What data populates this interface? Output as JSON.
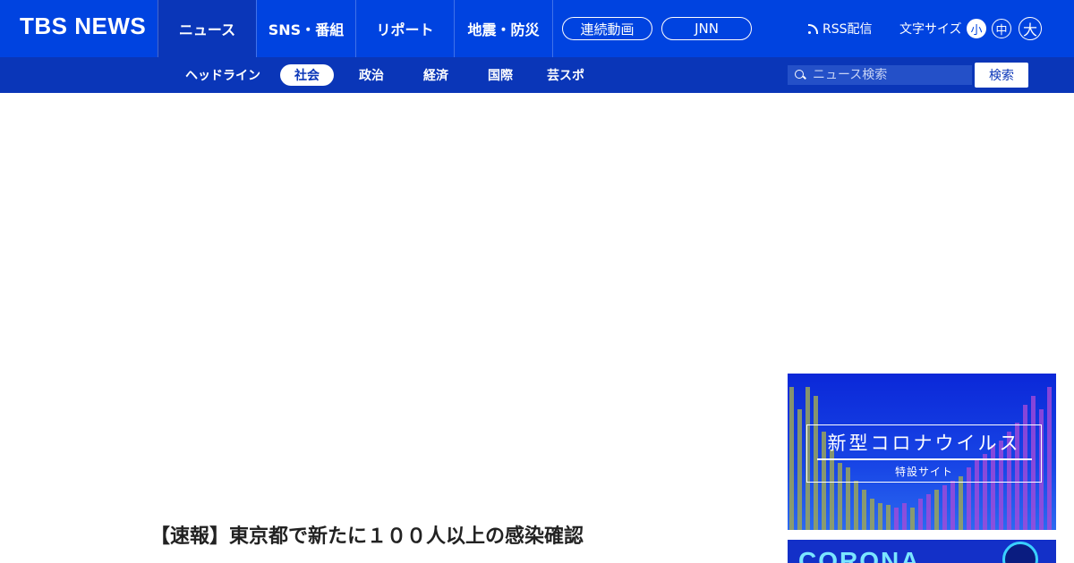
{
  "header": {
    "logo": "TBS NEWS",
    "tabs": [
      {
        "label": "ニュース"
      },
      {
        "label": "SNS・番組"
      },
      {
        "label": "リポート"
      },
      {
        "label": "地震・防災"
      }
    ],
    "pills": [
      {
        "label": "連続動画"
      },
      {
        "label": "JNN"
      }
    ],
    "rss_label": "RSS配信",
    "font_size_label": "文字サイズ",
    "font_sizes": [
      "小",
      "中",
      "大"
    ]
  },
  "subnav": {
    "items": [
      {
        "label": "ヘッドライン"
      },
      {
        "label": "社会"
      },
      {
        "label": "政治"
      },
      {
        "label": "経済"
      },
      {
        "label": "国際"
      },
      {
        "label": "芸スポ"
      }
    ],
    "search_placeholder": "ニュース検索",
    "search_button": "検索"
  },
  "article": {
    "headline": "【速報】東京都で新たに１００人以上の感染確認"
  },
  "side_banners": {
    "corona_title": "新型コロナウイルス",
    "corona_sub": "特設サイト",
    "corona2_text": "CORONA"
  },
  "colors": {
    "header_bg": "#0043e0",
    "subnav_bg": "#0a36b8"
  }
}
